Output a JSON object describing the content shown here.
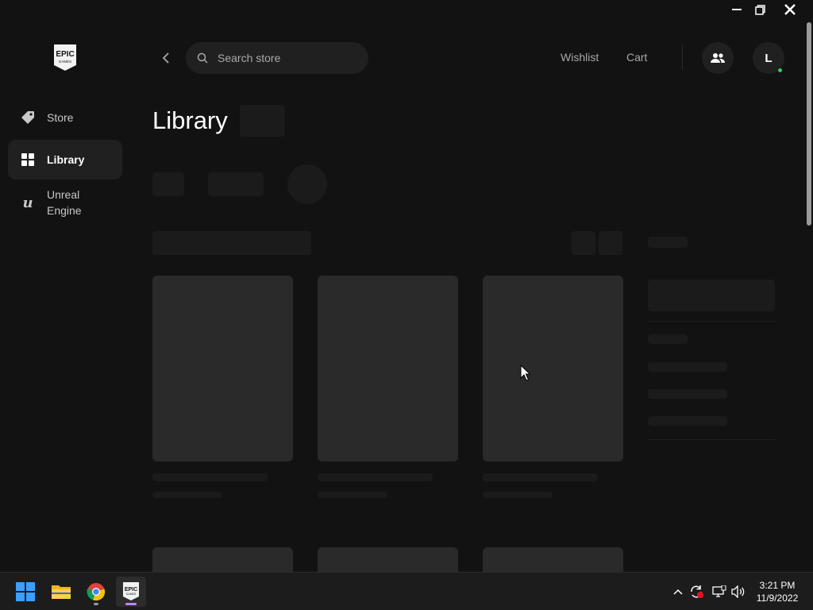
{
  "sidebar": {
    "logo_text_top": "EPIC",
    "logo_text_bottom": "GAMES",
    "items": [
      {
        "label": "Store",
        "icon": "tag-icon"
      },
      {
        "label": "Library",
        "icon": "grid-icon",
        "active": true
      },
      {
        "label": "Unreal Engine",
        "label_line1": "Unreal",
        "label_line2": "Engine",
        "icon": "unreal-icon"
      }
    ]
  },
  "header": {
    "search_placeholder": "Search store",
    "wishlist": "Wishlist",
    "cart": "Cart",
    "avatar_initial": "L"
  },
  "main": {
    "title": "Library"
  },
  "taskbar": {
    "time": "3:21 PM",
    "date": "11/9/2022",
    "epic_icon_text_top": "EPIC",
    "epic_icon_text_bottom": "GAMES"
  },
  "colors": {
    "background": "#121212",
    "sidebar_active": "#202020",
    "skeleton_card": "#2a2a2a",
    "skeleton_line": "#1b1b1b",
    "online_dot": "#2ecc71"
  }
}
